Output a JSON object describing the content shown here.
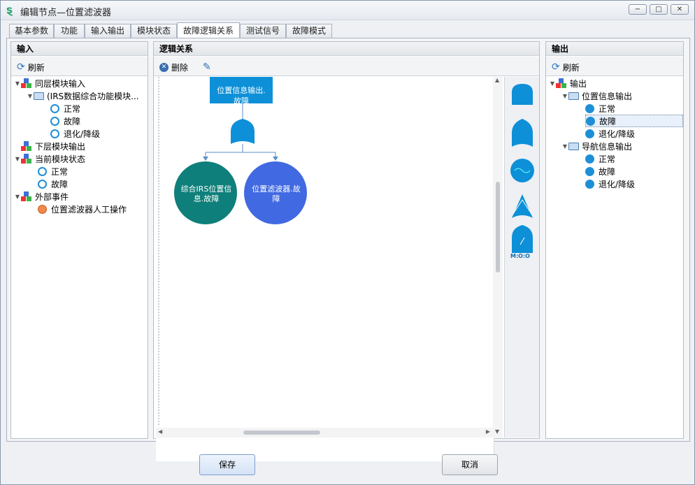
{
  "window": {
    "title": "编辑节点—位置滤波器"
  },
  "tabs": [
    "基本参数",
    "功能",
    "输入输出",
    "模块状态",
    "故障逻辑关系",
    "测试信号",
    "故障模式"
  ],
  "input_panel": {
    "header": "输入",
    "refresh": "刷新",
    "tree": [
      {
        "label": "同层模块输入",
        "type": "group"
      },
      {
        "label": "(IRS数据综合功能模块...",
        "type": "folder"
      },
      {
        "label": "正常",
        "type": "ring"
      },
      {
        "label": "故障",
        "type": "ring"
      },
      {
        "label": "退化/降级",
        "type": "ring"
      },
      {
        "label": "下层模块输出",
        "type": "group"
      },
      {
        "label": "当前模块状态",
        "type": "group"
      },
      {
        "label": "正常",
        "type": "ring"
      },
      {
        "label": "故障",
        "type": "ring"
      },
      {
        "label": "外部事件",
        "type": "group"
      },
      {
        "label": "位置滤波器人工操作",
        "type": "orange"
      }
    ]
  },
  "logic_panel": {
    "header": "逻辑关系",
    "delete": "删除",
    "output_node": "位置信息输出.\n故障",
    "child1": "综合IRS位置信\n息.故障",
    "child2": "位置滤波器.故\n障",
    "palette_mox": "M:O:O"
  },
  "output_panel": {
    "header": "输出",
    "refresh": "刷新",
    "tree": [
      {
        "label": "输出",
        "type": "group"
      },
      {
        "label": "位置信息输出",
        "type": "folder"
      },
      {
        "label": "正常",
        "type": "dot"
      },
      {
        "label": "故障",
        "type": "dot",
        "selected": true
      },
      {
        "label": "退化/降级",
        "type": "dot"
      },
      {
        "label": "导航信息输出",
        "type": "folder"
      },
      {
        "label": "正常",
        "type": "dot"
      },
      {
        "label": "故障",
        "type": "dot"
      },
      {
        "label": "退化/降级",
        "type": "dot"
      }
    ]
  },
  "buttons": {
    "save": "保存",
    "cancel": "取消"
  },
  "colors": {
    "accent": "#1e8fd6",
    "teal": "#0e7f7a",
    "royal": "#4169e1"
  }
}
